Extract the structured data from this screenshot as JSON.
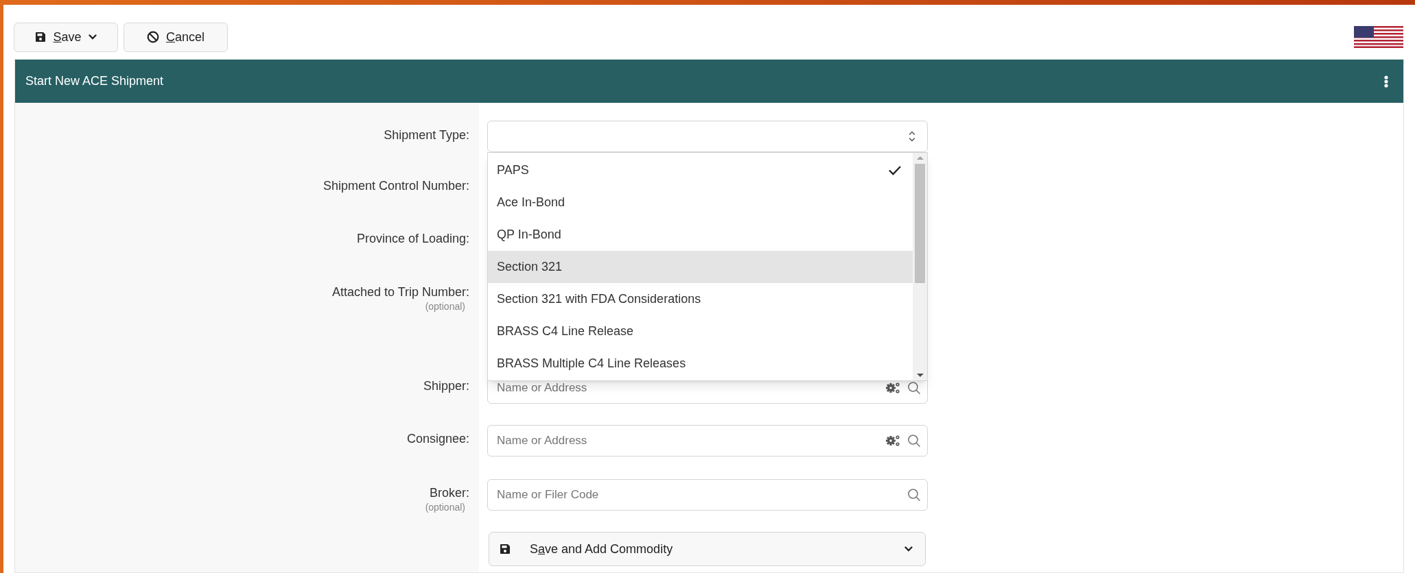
{
  "toolbar": {
    "buttons": [
      {
        "label": "Save",
        "kind": "save_menu"
      },
      {
        "label": "Cancel",
        "kind": "cancel"
      }
    ]
  },
  "panel": {
    "title": "Start New ACE Shipment"
  },
  "form": {
    "fields": [
      {
        "label": "Shipment Type:",
        "kind": "select",
        "expanded": true
      },
      {
        "label": "Shipment Control Number:",
        "kind": "covered"
      },
      {
        "label": "Province of Loading:",
        "kind": "covered"
      },
      {
        "label": "Attached to Trip Number:",
        "note": "(optional)",
        "kind": "covered"
      },
      {
        "label": "Shipper:",
        "kind": "lookup",
        "placeholder": "Name or Address",
        "settings_icon": true
      },
      {
        "label": "Consignee:",
        "kind": "lookup",
        "placeholder": "Name or Address",
        "settings_icon": true
      },
      {
        "label": "Broker:",
        "note": "(optional)",
        "kind": "lookup",
        "placeholder": "Name or Filer Code",
        "settings_icon": false
      }
    ]
  },
  "dropdown": {
    "options": [
      {
        "label": "PAPS",
        "selected": true,
        "highlighted": false
      },
      {
        "label": "Ace In-Bond",
        "selected": false,
        "highlighted": false
      },
      {
        "label": "QP In-Bond",
        "selected": false,
        "highlighted": false
      },
      {
        "label": "Section 321",
        "selected": false,
        "highlighted": true
      },
      {
        "label": "Section 321 with FDA Considerations",
        "selected": false,
        "highlighted": false
      },
      {
        "label": "BRASS C4 Line Release",
        "selected": false,
        "highlighted": false
      },
      {
        "label": "BRASS Multiple C4 Line Releases",
        "selected": false,
        "highlighted": false
      }
    ]
  },
  "submit": {
    "label": "Save and Add Commodity"
  }
}
